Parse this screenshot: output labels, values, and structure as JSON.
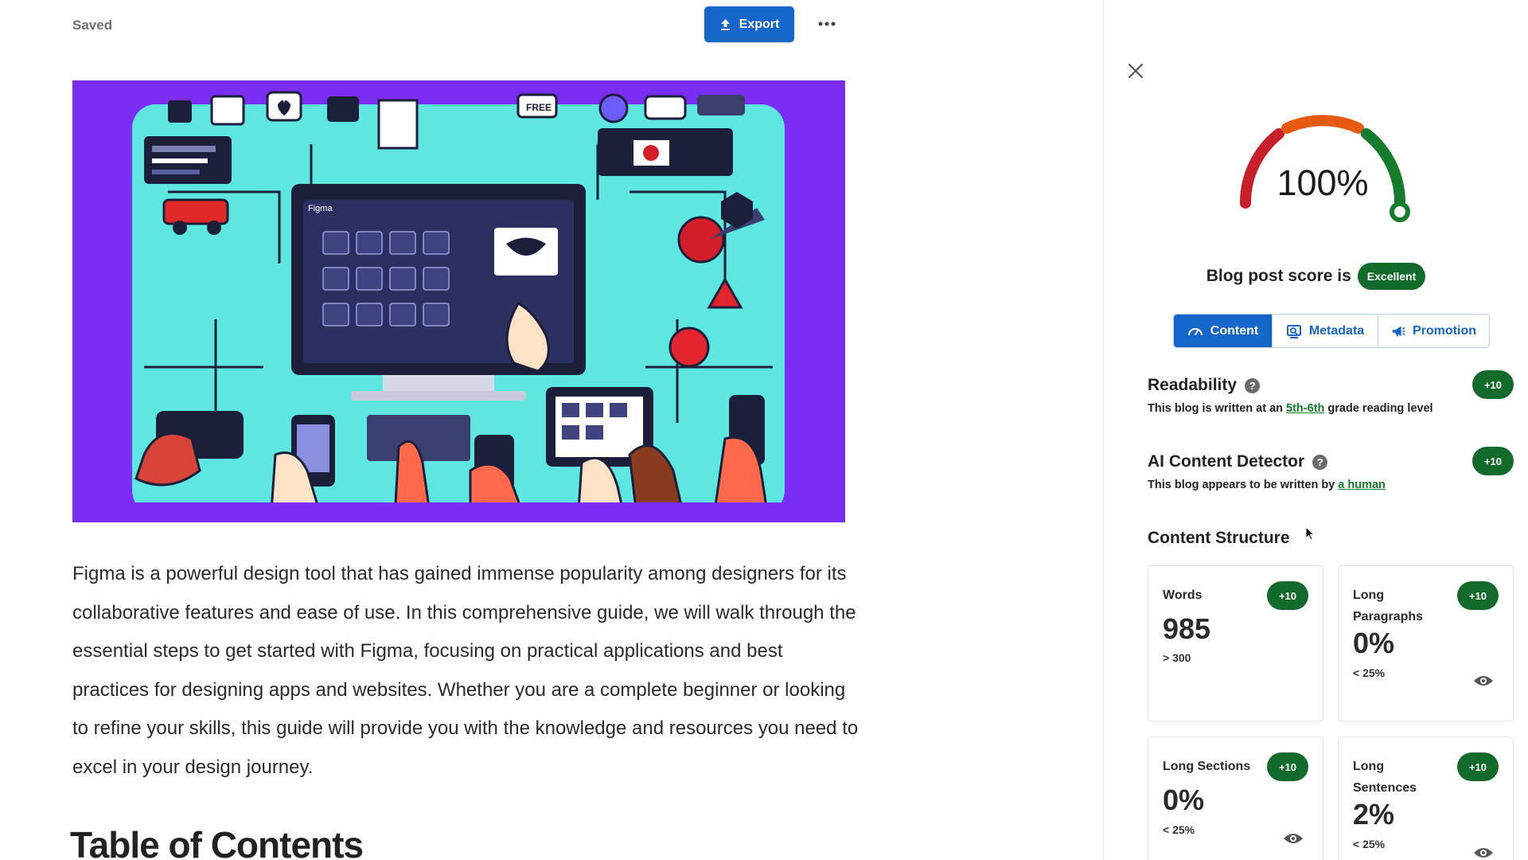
{
  "editor": {
    "status": "Saved",
    "export_label": "Export",
    "intro_paragraph": "Figma is a powerful design tool that has gained immense popularity among designers for its collaborative features and ease of use. In this comprehensive guide, we will walk through the essential steps to get started with Figma, focusing on practical applications and best practices for designing apps and websites. Whether you are a complete beginner or looking to refine your skills, this guide will provide you with the knowledge and resources you need to excel in your design journey.",
    "section_heading": "Table of Contents",
    "hero_caption": "Figma"
  },
  "panel": {
    "gauge_value": "100%",
    "gauge_fraction": 1.0,
    "score_prefix": "Blog post score is",
    "score_badge": "Excellent",
    "tabs": [
      {
        "label": "Content",
        "icon": "gauge-icon",
        "active": true
      },
      {
        "label": "Metadata",
        "icon": "metadata-icon",
        "active": false
      },
      {
        "label": "Promotion",
        "icon": "megaphone-icon",
        "active": false
      }
    ],
    "readability": {
      "title": "Readability",
      "desc_prefix": "This blog is written at an",
      "desc_link": "5th-6th",
      "desc_suffix": "grade reading level",
      "points": "+10"
    },
    "ai_detector": {
      "title": "AI Content Detector",
      "desc_prefix": "This blog appears to be written by",
      "desc_link": "a human",
      "points": "+10"
    },
    "structure_title": "Content Structure",
    "cards": [
      {
        "label": "Words",
        "value": "985",
        "sub": "> 300",
        "points": "+10"
      },
      {
        "label": "Long Paragraphs",
        "value": "0%",
        "sub": "< 25%",
        "points": "+10"
      },
      {
        "label": "Long Sections",
        "value": "0%",
        "sub": "< 25%",
        "points": "+10"
      },
      {
        "label": "Long Sentences",
        "value": "2%",
        "sub": "< 25%",
        "points": "+10"
      }
    ],
    "help_glyph": "?"
  },
  "colors": {
    "accent": "#1466c8",
    "success": "#136b2b",
    "hero_bg": "#7a2df3",
    "hero_panel": "#56e6e2"
  }
}
